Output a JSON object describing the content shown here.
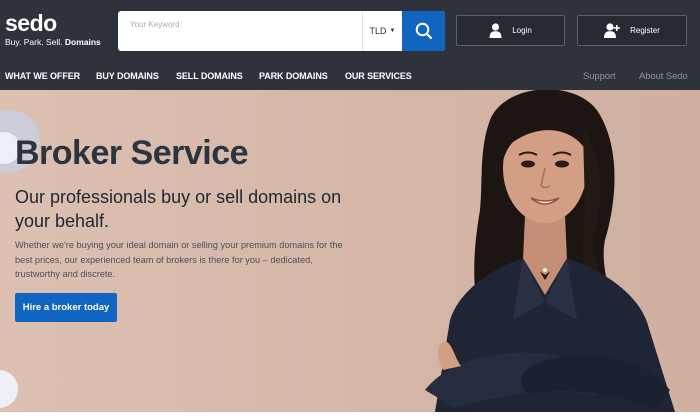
{
  "logo": {
    "word": "sedo",
    "tagline": "Buy. Park. Sell.",
    "tagline_bold": "Domains"
  },
  "search": {
    "placeholder": "Your Keyword",
    "tld_label": "TLD",
    "icon": "search-icon"
  },
  "account": {
    "login_label": "Login",
    "register_label": "Register",
    "login_icon": "user-icon",
    "register_icon": "user-add-icon"
  },
  "nav": {
    "items": [
      {
        "label": "WHAT WE OFFER"
      },
      {
        "label": "BUY DOMAINS"
      },
      {
        "label": "SELL DOMAINS"
      },
      {
        "label": "PARK DOMAINS"
      },
      {
        "label": "OUR SERVICES"
      }
    ],
    "right": [
      {
        "label": "Support"
      },
      {
        "label": "About Sedo"
      }
    ]
  },
  "hero": {
    "title": "Broker Service",
    "subtitle": "Our professionals buy or sell domains on your behalf.",
    "body": "Whether we're buying your ideal domain or selling your premium domains for the best prices, our experienced team of brokers is there for you – dedicated, trustworthy and discrete.",
    "cta_label": "Hire a broker today"
  },
  "colors": {
    "header_bg": "#2e333b",
    "accent_blue": "#0f65c0",
    "hero_bg": "#d5b8aa",
    "title_text": "#2c3440"
  }
}
